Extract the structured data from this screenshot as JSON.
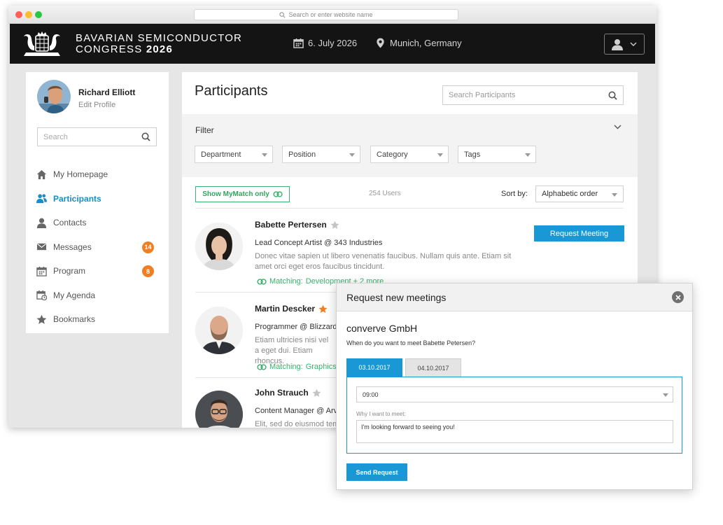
{
  "browser": {
    "url_placeholder": "Search or enter website name"
  },
  "header": {
    "title_line1": "BAVARIAN SEMICONDUCTOR",
    "title_line2_a": "CONGRESS",
    "title_line2_b": "2026",
    "date": "6. July 2026",
    "location": "Munich, Germany"
  },
  "profile": {
    "name": "Richard Elliott",
    "edit": "Edit Profile"
  },
  "sidebar": {
    "search_placeholder": "Search",
    "items": [
      {
        "label": "My Homepage",
        "icon": "home-icon"
      },
      {
        "label": "Participants",
        "icon": "people-icon",
        "active": true
      },
      {
        "label": "Contacts",
        "icon": "person-icon"
      },
      {
        "label": "Messages",
        "icon": "envelope-icon",
        "badge": "14"
      },
      {
        "label": "Program",
        "icon": "calendar-icon",
        "badge": "8"
      },
      {
        "label": "My Agenda",
        "icon": "agenda-icon"
      },
      {
        "label": "Bookmarks",
        "icon": "star-icon"
      }
    ]
  },
  "main": {
    "title": "Participants",
    "search_placeholder": "Search Participants",
    "filter": {
      "title": "Filter",
      "dropdowns": [
        "Department",
        "Position",
        "Category",
        "Tags"
      ]
    },
    "mymatch_label": "Show MyMatch only",
    "user_count": "254 Users",
    "sort_label": "Sort by:",
    "sort_value": "Alphabetic order",
    "request_button": "Request Meeting",
    "participants": [
      {
        "name": "Babette Pertersen",
        "starred": false,
        "role": "Lead Concept Artist @ 343 Industries",
        "text": "Donec vitae sapien ut libero venenatis faucibus. Nullam quis ante. Etiam sit amet orci eget eros faucibus tincidunt.",
        "match_label": "Matching:",
        "match_value": "Development + 2 more"
      },
      {
        "name": "Martin Descker",
        "starred": true,
        "role": "Programmer @  Blizzard",
        "text": "Etiam ultricies nisi vel a eget dui. Etiam rhoncus.",
        "match_label": "Matching:",
        "match_value": "Graphics"
      },
      {
        "name": "John Strauch",
        "starred": false,
        "role": "Content Manager @ Arvo",
        "text": "Elit, sed do eiusmod tem",
        "match_label": "",
        "match_value": ""
      }
    ]
  },
  "modal": {
    "title": "Request new meetings",
    "company": "converve GmbH",
    "question": "When do you want to meet Babette Petersen?",
    "tabs": [
      "03.10.2017",
      "04.10.2017"
    ],
    "time_value": "09:00",
    "why_label": "Why I want to meet:",
    "message": "I'm looking forward to seeing you!",
    "send_label": "Send Request"
  },
  "colors": {
    "accent": "#1a98d5",
    "badge": "#f07e22",
    "match": "#35b36a",
    "header_bg": "#141414"
  }
}
